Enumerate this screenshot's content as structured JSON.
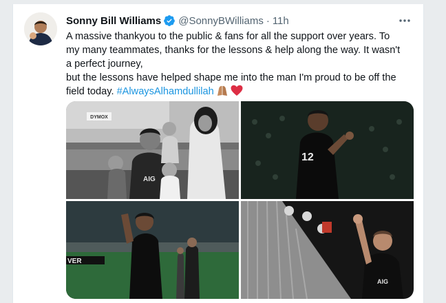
{
  "tweet": {
    "author_name": "Sonny Bill Williams",
    "author_handle": "@SonnyBWilliams",
    "separator": "·",
    "time": "11h",
    "lines": [
      "A massive thankyou to the public & fans for all the support over years. To",
      "my many teammates, thanks for the lessons & help along the way. It wasn't",
      "a perfect journey,",
      "but the lessons have helped shape me into the man I'm proud to be off the",
      "field today."
    ],
    "hashtag": "#AlwaysAlhamdullilah",
    "emojis": [
      "folded-hands-emoji",
      "red-heart-emoji"
    ]
  },
  "icons": {
    "verified": "verified-badge-icon",
    "more": "more-options-icon"
  },
  "media": {
    "photos": [
      {
        "name": "photo-family-stadium",
        "jersey": "",
        "style": "black-and-white"
      },
      {
        "name": "photo-player-night",
        "jersey": "12",
        "style": "color"
      },
      {
        "name": "photo-player-stadium",
        "jersey": "",
        "style": "color"
      },
      {
        "name": "photo-player-fans",
        "jersey": "",
        "sponsor": "AIG",
        "style": "color"
      }
    ],
    "banner_text": "VER",
    "photo1_sign": "DYMOX",
    "photo1_jersey_text": "AIG"
  },
  "colors": {
    "accent": "#1b95e0",
    "text": "#0f1419",
    "secondary": "#536471",
    "verified": "#1d9bf0"
  }
}
